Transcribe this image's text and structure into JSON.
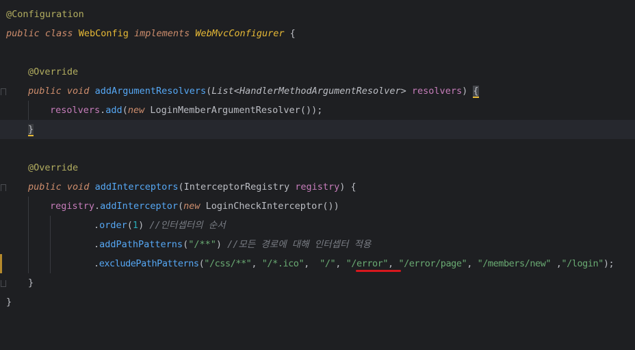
{
  "editor": {
    "lines": [
      {
        "a": "@Configuration"
      },
      {
        "k1": "public",
        "k2": "class",
        "name": "WebConfig",
        "k3": "implements",
        "iface": "WebMvcConfigurer",
        "brace": "{"
      },
      {},
      {
        "ann": "@Override"
      },
      {
        "k1": "public",
        "k2": "void",
        "fn": "addArgumentResolvers",
        "p1": "(",
        "type": "List",
        "lt": "<",
        "gen": "HandlerMethodArgumentResolver",
        "gt": ">",
        "param": "resolvers",
        "p2": ")",
        "brace": "{"
      },
      {
        "field": "resolvers",
        "dot": ".",
        "fn": "add",
        "p1": "(",
        "kw": "new",
        "cls": "LoginMemberArgumentResolver",
        "rest": "());"
      },
      {
        "brace": "}"
      },
      {},
      {
        "ann": "@Override"
      },
      {
        "k1": "public",
        "k2": "void",
        "fn": "addInterceptors",
        "p1": "(",
        "type": "InterceptorRegistry",
        "param": "registry",
        "p2": ")",
        "brace": "{"
      },
      {
        "field": "registry",
        "dot": ".",
        "fn": "addInterceptor",
        "p1": "(",
        "kw": "new",
        "cls": "LoginCheckInterceptor",
        "rest": "())"
      },
      {
        "dot": ".",
        "fn": "order",
        "p1": "(",
        "num": "1",
        "p2": ")",
        "cmt": "//인터셉터의 순서"
      },
      {
        "dot": ".",
        "fn": "addPathPatterns",
        "p1": "(",
        "str": "\"/**\"",
        "p2": ")",
        "cmt": "//모든 경로에 대해 인터셉터 적용"
      },
      {
        "dot": ".",
        "fn": "excludePathPatterns",
        "p1": "(",
        "s1": "\"/css/**\"",
        "c1": ", ",
        "s2": "\"/*.ico\"",
        "c2": ",  ",
        "s3": "\"/\"",
        "c3": ", ",
        "s4": "\"/error\"",
        "c4": ", ",
        "s5": "\"/error/page\"",
        "c5": ", ",
        "s6": "\"/members/new\"",
        "c6": " ,",
        "s7": "\"/login\"",
        "p2": ");"
      },
      {
        "brace": "}"
      },
      {
        "brace": "}"
      }
    ]
  },
  "colors": {
    "background": "#1e1f22",
    "current_line": "#26282e",
    "keyword": "#cf8e6d",
    "annotation": "#b3ae60",
    "method": "#56a8f5",
    "field_param": "#c77dbb",
    "string": "#6aab73",
    "number": "#2aacb8",
    "comment": "#7a7e85",
    "highlight_underline": "#d8171e"
  }
}
